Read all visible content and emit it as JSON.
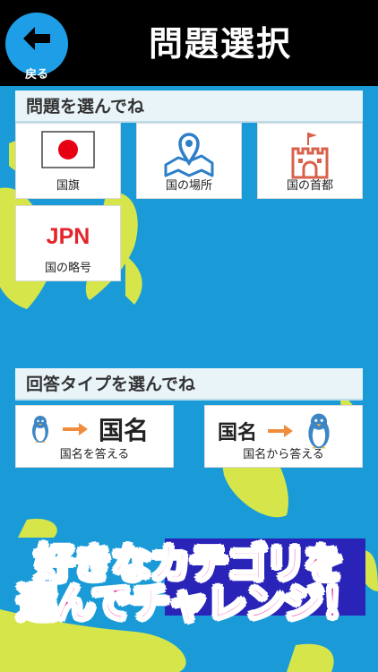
{
  "header": {
    "back_label": "戻る",
    "title": "問題選択"
  },
  "question_section": {
    "header": "問題を選んでね",
    "items": [
      {
        "label": "国旗",
        "icon": "flag-icon"
      },
      {
        "label": "国の場所",
        "icon": "map-pin-icon"
      },
      {
        "label": "国の首都",
        "icon": "castle-icon"
      },
      {
        "label": "国の略号",
        "icon": "abbreviation-icon",
        "icon_text": "JPN"
      }
    ]
  },
  "answer_section": {
    "header": "回答タイプを選んでね",
    "items": [
      {
        "label": "国名を答える",
        "icon_text": "国名"
      },
      {
        "label": "国名から答える",
        "icon_text": "国名"
      }
    ]
  },
  "banner": {
    "line1": "好きなカテゴリを",
    "line2": "選んでチャレンジ！"
  },
  "colors": {
    "sea": "#1a9bd8",
    "land": "#d6e64a",
    "accent_blue": "#1e9ee6",
    "flag_red": "#e60012",
    "abbr_red": "#e3242b",
    "arrow_orange": "#f08c3c",
    "banner_pink": "#f0168b",
    "banner_bg": "#2a23b8"
  }
}
